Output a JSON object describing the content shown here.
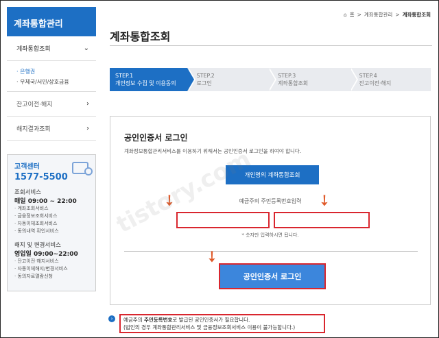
{
  "sidebar": {
    "title": "계좌통합관리",
    "menu1": "계좌통합조회",
    "sub_items": [
      "· 은행권",
      "· 우체국/서민/상호금융"
    ],
    "items": [
      "잔고이전·해지",
      "해지결과조회"
    ]
  },
  "customer_center": {
    "title": "고객센터",
    "phone": "1577-5500",
    "inquiry_title": "조회서비스",
    "inquiry_time": "매일 09:00 ~ 22:00",
    "inquiry_list": [
      "· 계좌조회서비스",
      "· 금융정보조회서비스",
      "· 자동이체조회서비스",
      "· 동의내역 확인서비스"
    ],
    "change_title": "해지 및 변경서비스",
    "change_time": "영업일 09:00~22:00",
    "change_list": [
      "· 잔고이전·해지서비스",
      "· 자동이체해지/변경서비스",
      "· 동의자료열람신청"
    ]
  },
  "breadcrumb": {
    "home": "홈",
    "sep": ">",
    "level1": "계좌통합관리",
    "current": "계좌통합조회"
  },
  "page_title": "계좌통합조회",
  "steps": [
    {
      "num": "STEP.1",
      "label": "개인정보 수집 및 이용동의"
    },
    {
      "num": "STEP.2",
      "label": "로그인"
    },
    {
      "num": "STEP.3",
      "label": "계좌통합조회"
    },
    {
      "num": "STEP.4",
      "label": "잔고이전·해지"
    }
  ],
  "login": {
    "title": "공인인증서 로그인",
    "description": "계좌정보통합관리서비스를 이용하기 위해서는 공인인증서 로그인을 하여야 합니다.",
    "personal_button": "개인명의 계좌통합조회",
    "rrn_label": "예금주의 주민등록번호입력",
    "rrn_first_value": "",
    "rrn_second_value": "",
    "rrn_note": "* 숫자만 입력하시면 됩니다.",
    "cert_button": "공인인증서 로그인"
  },
  "notice": {
    "line1_pre": "예금주의 ",
    "line1_bold": "주민등록번호",
    "line1_post": "로 발급된 공인인증서가 필요합니다.",
    "line2": "(법인의 경우 계좌통합관리서비스 및 금융정보조회서비스 이용이 불가능합니다.)"
  },
  "watermark": "tistory.com",
  "colors": {
    "primary": "#1d6fc4",
    "highlight": "#d9262e",
    "arrow": "#e05a2a"
  }
}
